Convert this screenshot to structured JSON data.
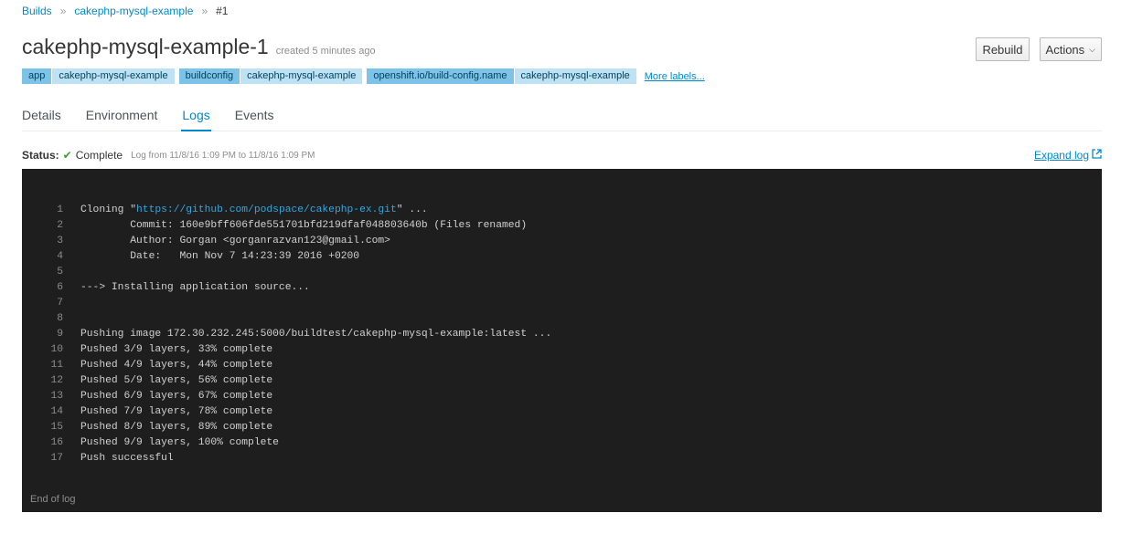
{
  "breadcrumb": {
    "items": [
      "Builds",
      "cakephp-mysql-example"
    ],
    "current": "#1",
    "separator": "»"
  },
  "header": {
    "title": "cakephp-mysql-example-1",
    "created": "created 5 minutes ago",
    "rebuild_label": "Rebuild",
    "actions_label": "Actions"
  },
  "labels": [
    {
      "key": "app",
      "value": "cakephp-mysql-example"
    },
    {
      "key": "buildconfig",
      "value": "cakephp-mysql-example"
    },
    {
      "key": "openshift.io/build-config.name",
      "value": "cakephp-mysql-example"
    }
  ],
  "more_labels": "More labels...",
  "tabs": [
    {
      "label": "Details",
      "active": false
    },
    {
      "label": "Environment",
      "active": false
    },
    {
      "label": "Logs",
      "active": true
    },
    {
      "label": "Events",
      "active": false
    }
  ],
  "status": {
    "key": "Status:",
    "value": "Complete",
    "log_time": "Log from 11/8/16 1:09 PM to 11/8/16 1:09 PM",
    "expand_label": "Expand log"
  },
  "log": {
    "lines": [
      {
        "n": "1",
        "pre": "Cloning \"",
        "url": "https://github.com/podspace/cakephp-ex.git",
        "post": "\" ..."
      },
      {
        "n": "2",
        "pre": "        Commit: 160e9bff606fde551701bfd219dfaf048803640b (Files renamed)",
        "url": "",
        "post": ""
      },
      {
        "n": "3",
        "pre": "        Author: Gorgan <gorganrazvan123@gmail.com>",
        "url": "",
        "post": ""
      },
      {
        "n": "4",
        "pre": "        Date:   Mon Nov 7 14:23:39 2016 +0200",
        "url": "",
        "post": ""
      },
      {
        "n": "5",
        "pre": "",
        "url": "",
        "post": ""
      },
      {
        "n": "6",
        "pre": "---> Installing application source...",
        "url": "",
        "post": ""
      },
      {
        "n": "7",
        "pre": "",
        "url": "",
        "post": ""
      },
      {
        "n": "8",
        "pre": "",
        "url": "",
        "post": ""
      },
      {
        "n": "9",
        "pre": "Pushing image 172.30.232.245:5000/buildtest/cakephp-mysql-example:latest ...",
        "url": "",
        "post": ""
      },
      {
        "n": "10",
        "pre": "Pushed 3/9 layers, 33% complete",
        "url": "",
        "post": ""
      },
      {
        "n": "11",
        "pre": "Pushed 4/9 layers, 44% complete",
        "url": "",
        "post": ""
      },
      {
        "n": "12",
        "pre": "Pushed 5/9 layers, 56% complete",
        "url": "",
        "post": ""
      },
      {
        "n": "13",
        "pre": "Pushed 6/9 layers, 67% complete",
        "url": "",
        "post": ""
      },
      {
        "n": "14",
        "pre": "Pushed 7/9 layers, 78% complete",
        "url": "",
        "post": ""
      },
      {
        "n": "15",
        "pre": "Pushed 8/9 layers, 89% complete",
        "url": "",
        "post": ""
      },
      {
        "n": "16",
        "pre": "Pushed 9/9 layers, 100% complete",
        "url": "",
        "post": ""
      },
      {
        "n": "17",
        "pre": "Push successful",
        "url": "",
        "post": ""
      }
    ],
    "end_label": "End of log"
  },
  "colors": {
    "accent": "#0088ce",
    "success": "#3f9c35",
    "console_bg": "#1e1e1e"
  },
  "icons": {
    "status": "check-icon",
    "expand": "external-link-icon",
    "actions": "caret-down-icon"
  }
}
